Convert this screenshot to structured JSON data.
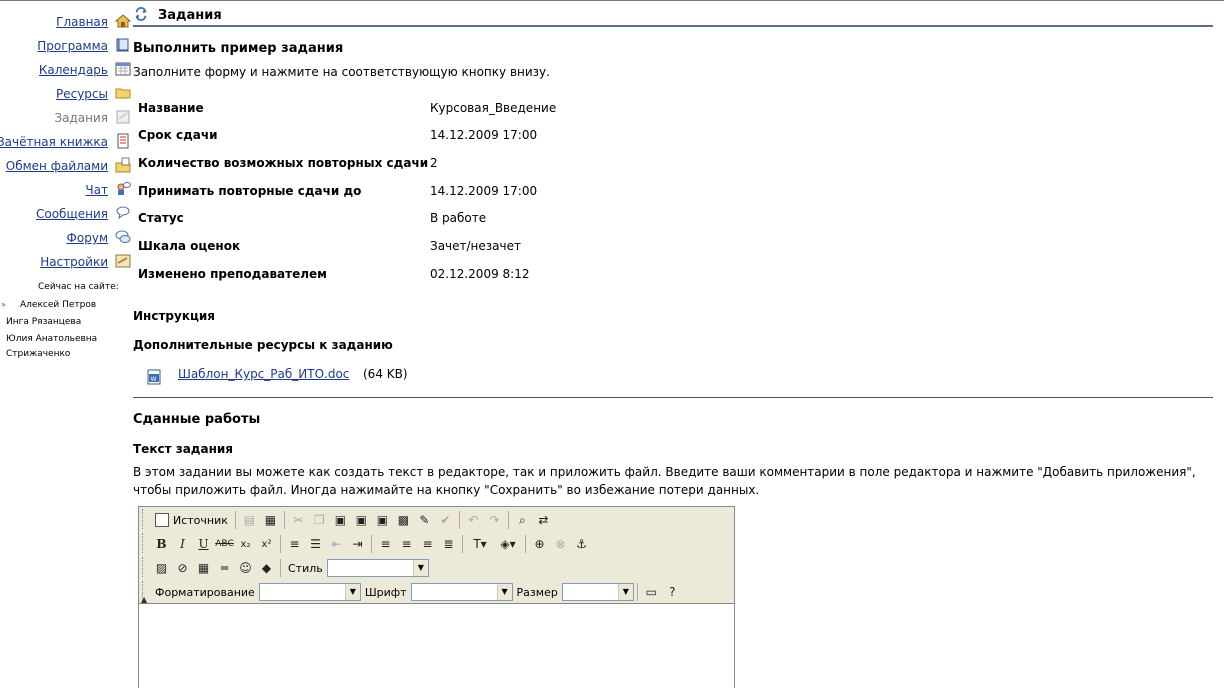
{
  "sidebar": {
    "items": [
      {
        "label": "Главная"
      },
      {
        "label": "Программа"
      },
      {
        "label": "Календарь"
      },
      {
        "label": "Ресурсы"
      },
      {
        "label": "Задания"
      },
      {
        "label": "Зачётная книжка"
      },
      {
        "label": "Обмен файлами"
      },
      {
        "label": "Чат"
      },
      {
        "label": "Сообщения"
      },
      {
        "label": "Форум"
      },
      {
        "label": "Настройки"
      }
    ],
    "online_label": "Сейчас на сайте:",
    "online_users": [
      "Алексей Петров",
      "Инга Рязанцева",
      "Юлия Анатольевна",
      "Стрижаченко"
    ]
  },
  "header": {
    "title": "Задания"
  },
  "task": {
    "heading": "Выполнить пример задания",
    "subtitle": "Заполните форму и нажмите на соответствующую кнопку внизу.",
    "rows": [
      {
        "label": "Название",
        "value": "Курсовая_Введение"
      },
      {
        "label": "Срок сдачи",
        "value": "14.12.2009 17:00"
      },
      {
        "label": "Количество возможных повторных сдачи",
        "value": "2"
      },
      {
        "label": "Принимать повторные сдачи до",
        "value": "14.12.2009 17:00"
      },
      {
        "label": "Статус",
        "value": "В работе"
      },
      {
        "label": "Шкала оценок",
        "value": "Зачет/незачет"
      },
      {
        "label": "Изменено преподавателем",
        "value": "02.12.2009 8:12"
      }
    ],
    "instruction_heading": "Инструкция",
    "resources_heading": "Дополнительные ресурсы к заданию",
    "resource": {
      "name": "Шаблон_Курс_Раб_ИТО.doc",
      "size": "(64 KB)"
    }
  },
  "submissions": {
    "heading": "Сданные работы",
    "text_heading": "Текст задания",
    "description": "В этом задании вы можете как создать текст в редакторе, так и приложить файл. Введите ваши комментарии в поле редактора и нажмите \"Добавить приложения\", чтобы приложить файл. Иногда нажимайте на кнопку \"Сохранить\" во избежание потери данных."
  },
  "editor": {
    "source_label": "Источник",
    "style_label": "Стиль",
    "format_label": "Форматирование",
    "font_label": "Шрифт",
    "size_label": "Размер"
  }
}
